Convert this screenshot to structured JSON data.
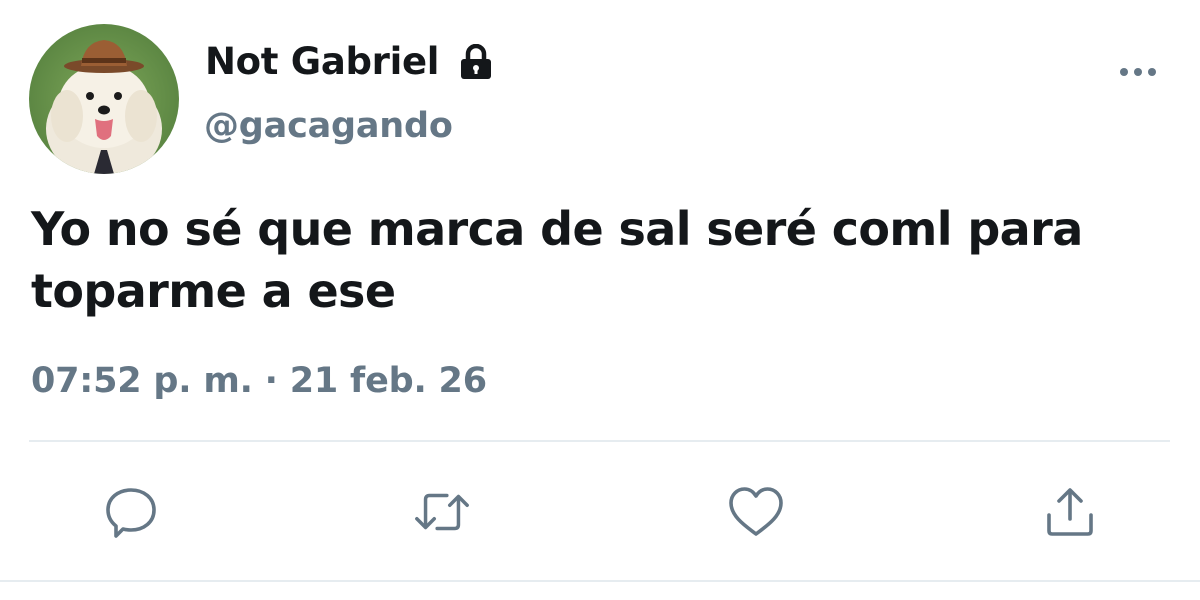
{
  "user": {
    "display_name": "Not Gabriel",
    "handle": "@gacagando",
    "protected": true,
    "avatar": "dog-with-hat-photo"
  },
  "tweet": {
    "text": "Yo no sé que marca de sal seré coml para toparme a ese",
    "timestamp": "07:52 p. m. · 21 feb. 26"
  },
  "icons": {
    "more": "more-horizontal-icon",
    "lock": "lock-icon",
    "reply": "reply-icon",
    "retweet": "retweet-icon",
    "like": "heart-icon",
    "share": "share-icon"
  },
  "colors": {
    "text": "#14171a",
    "secondary": "#657786",
    "icon": "#657786",
    "divider": "#e6ecf0"
  }
}
